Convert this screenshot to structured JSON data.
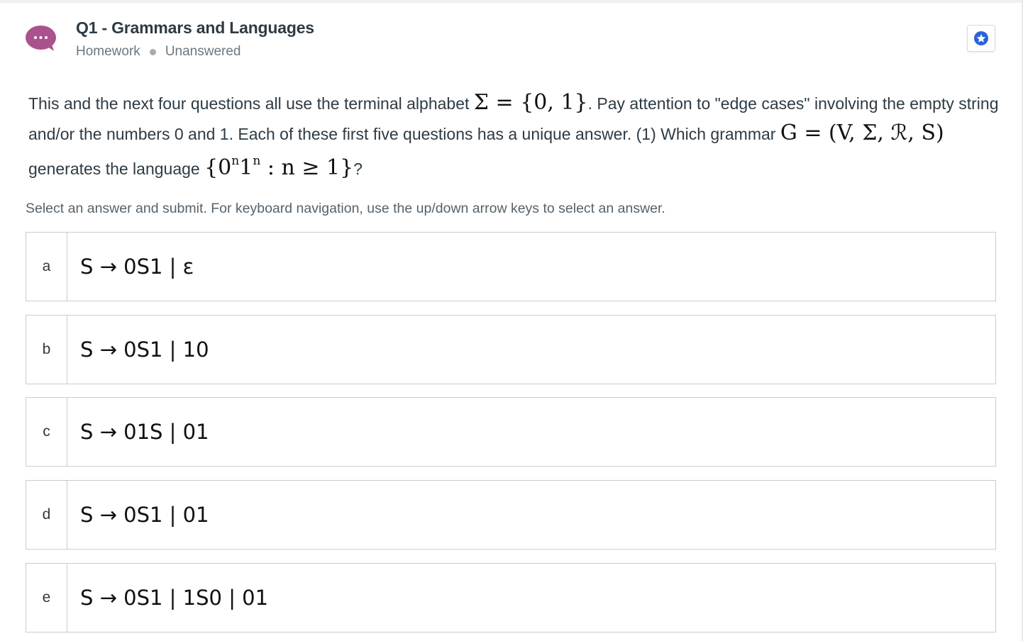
{
  "header": {
    "title": "Q1 - Grammars and Languages",
    "category": "Homework",
    "status": "Unanswered",
    "avatar_icon": "speech-bubble-ellipsis-icon",
    "avatar_color": "#a9528d",
    "star_icon": "star-icon",
    "star_color": "#2a64d6"
  },
  "question": {
    "p1": "This and the next four questions all use the terminal alphabet",
    "m1": "Σ = {0, 1}",
    "p2": ". Pay attention to \"edge cases\" involving the empty string and/or the numbers 0 and 1. Each of these first five questions has a unique answer. (1) Which grammar",
    "m2": "G = (V, Σ, ℛ, S)",
    "p3": "generates the language",
    "m3_open": "{0",
    "m3_sup1": "n",
    "m3_mid": "1",
    "m3_sup2": "n",
    "m3_close": " : n ≥ 1}",
    "p4": "?"
  },
  "instructions": "Select an answer and submit. For keyboard navigation, use the up/down arrow keys to select an answer.",
  "options": [
    {
      "letter": "a",
      "expr": "S → 0S1 | ε"
    },
    {
      "letter": "b",
      "expr": "S → 0S1 | 10"
    },
    {
      "letter": "c",
      "expr": "S → 01S | 01"
    },
    {
      "letter": "d",
      "expr": "S → 0S1 | 01"
    },
    {
      "letter": "e",
      "expr": "S → 0S1 | 1S0 | 01"
    }
  ]
}
